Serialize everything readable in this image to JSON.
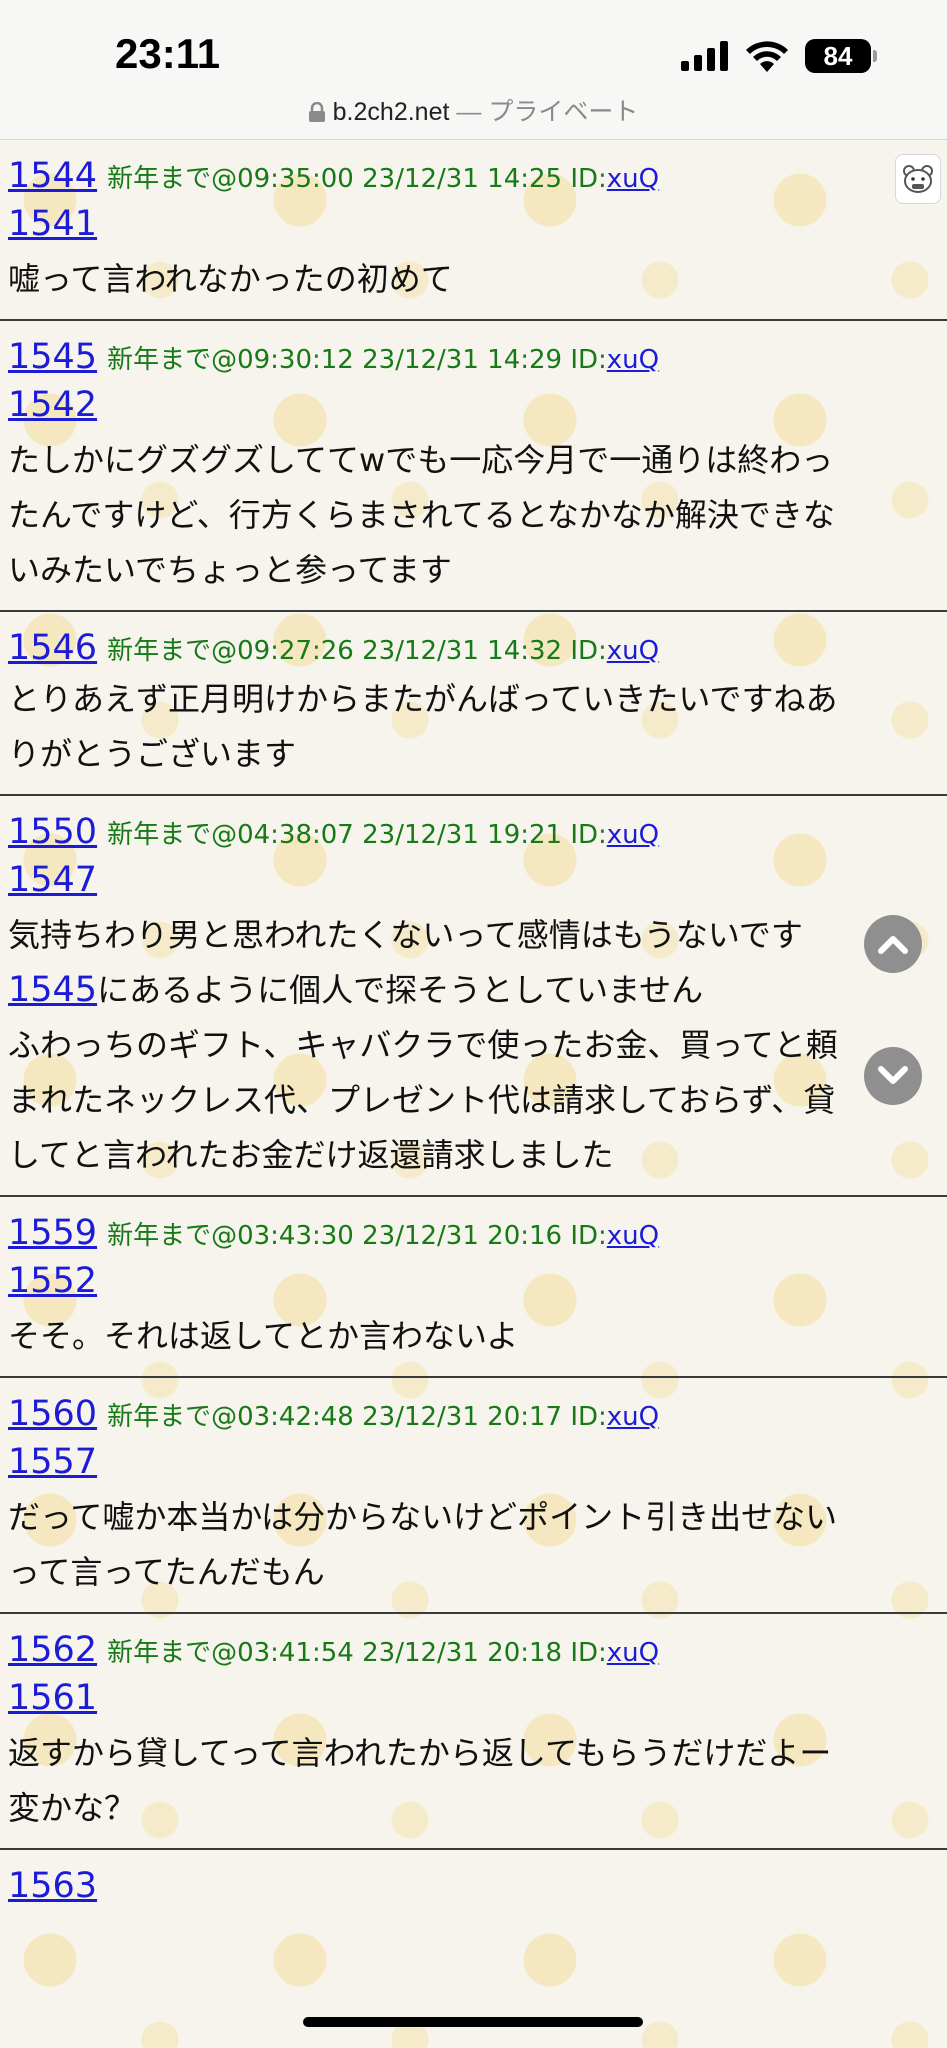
{
  "status": {
    "time": "23:11",
    "battery": "84"
  },
  "browser": {
    "domain": "b.2ch2.net",
    "separator": "—",
    "mode": "プライベート"
  },
  "posts": [
    {
      "number": "1544",
      "meta": "新年まで@09:35:00 23/12/31 14:25 ID:",
      "id": "xuQ",
      "reply": "1541",
      "lines": [
        "嘘って言われなかったの初めて"
      ]
    },
    {
      "number": "1545",
      "meta": "新年まで@09:30:12 23/12/31 14:29 ID:",
      "id": "xuQ",
      "reply": "1542",
      "lines": [
        "たしかにグズグズしててwでも一応今月で一通りは終わっ",
        "たんですけど、行方くらまされてるとなかなか解決できな",
        "いみたいでちょっと参ってます"
      ]
    },
    {
      "number": "1546",
      "meta": "新年まで@09:27:26 23/12/31 14:32 ID:",
      "id": "xuQ",
      "reply": "",
      "lines": [
        "とりあえず正月明けからまたがんばっていきたいですねあ",
        "りがとうございます"
      ]
    },
    {
      "number": "1550",
      "meta": "新年まで@04:38:07 23/12/31 19:21 ID:",
      "id": "xuQ",
      "reply": "1547",
      "lines": [
        "気持ちわり男と思われたくないって感情はもうないです"
      ],
      "inline_reply": "1545",
      "inline_text": "にあるように個人で探そうとしていません",
      "more_lines": [
        "ふわっちのギフト、キャバクラで使ったお金、買ってと頼",
        "まれたネックレス代、プレゼント代は請求しておらず、貸",
        "してと言われたお金だけ返還請求しました"
      ]
    },
    {
      "number": "1559",
      "meta": "新年まで@03:43:30 23/12/31 20:16 ID:",
      "id": "xuQ",
      "reply": "1552",
      "lines": [
        "そそ。それは返してとか言わないよ"
      ]
    },
    {
      "number": "1560",
      "meta": "新年まで@03:42:48 23/12/31 20:17 ID:",
      "id": "xuQ",
      "reply": "1557",
      "lines": [
        "だって嘘か本当かは分からないけどポイント引き出せない",
        "って言ってたんだもん"
      ]
    },
    {
      "number": "1562",
      "meta": "新年まで@03:41:54 23/12/31 20:18 ID:",
      "id": "xuQ",
      "reply": "1561",
      "lines": [
        "返すから貸してって言われたから返してもらうだけだよー",
        "変かな？"
      ]
    },
    {
      "number": "1563",
      "meta": "",
      "id": "",
      "reply": "",
      "lines": []
    }
  ],
  "icons": {
    "aa": "bear-face-icon",
    "scroll_up": "chevron-up-icon",
    "scroll_down": "chevron-down-icon"
  },
  "colors": {
    "link": "#1c1cd6",
    "meta": "#177a17",
    "divider": "#3a3a3a"
  }
}
